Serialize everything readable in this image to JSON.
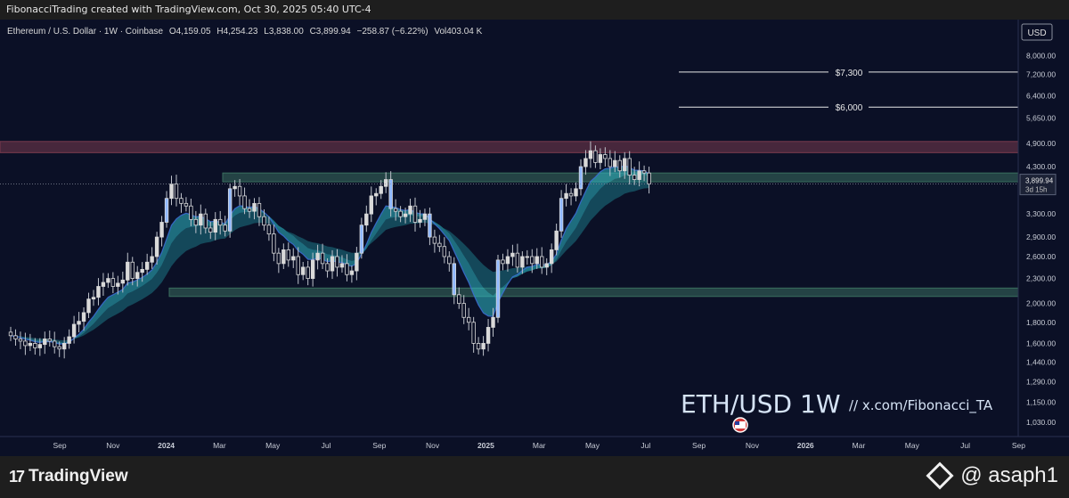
{
  "header": {
    "attribution": "FibonacciTrading created with TradingView.com, Oct 30, 2025 05:40 UTC-4"
  },
  "legend": {
    "symbol": "Ethereum / U.S. Dollar · 1W · Coinbase",
    "open": "O4,159.05",
    "high": "H4,254.23",
    "low": "L3,838.00",
    "close": "C3,899.94",
    "change": "−258.87 (−6.22%)",
    "volume": "Vol403.04 K"
  },
  "currency_label": "USD",
  "price_tag": {
    "value": "3,899.94",
    "countdown": "3d 15h"
  },
  "watermark": {
    "title": "ETH/USD 1W",
    "handle": "//  x.com/Fibonacci_TA"
  },
  "footer": {
    "brand": "TradingView",
    "credit": "@ asaph1"
  },
  "colors": {
    "background": "#0b1026",
    "candle_up": "#d9d9d9",
    "candle_down": "#d9d9d9",
    "candle_highlight": "#8fb8ff",
    "band_fast": "#2fb9c7",
    "band_slow": "#1e7f8e",
    "band_down": "#3f6fe0",
    "resistance_zone": "#7a3a4e",
    "support_zone": "#3a6e5e"
  },
  "chart_data": {
    "type": "candlestick",
    "y_axis": {
      "scale": "log",
      "range": [
        950,
        9500
      ],
      "ticks": [
        "8,000.00",
        "7,200.00",
        "6,400.00",
        "5,650.00",
        "4,900.00",
        "4,300.00",
        "3,300.00",
        "2,900.00",
        "2,600.00",
        "2,300.00",
        "2,000.00",
        "1,800.00",
        "1,600.00",
        "1,440.00",
        "1,290.00",
        "1,150.00",
        "1,030.00"
      ]
    },
    "x_axis": {
      "ticks": [
        "Sep",
        "Nov",
        "2024",
        "Mar",
        "May",
        "Jul",
        "Sep",
        "Nov",
        "2025",
        "Mar",
        "May",
        "Jul",
        "Sep",
        "Nov",
        "2026",
        "Mar",
        "May",
        "Jul",
        "Sep"
      ]
    },
    "horizontal_levels": [
      {
        "label": "$7,300",
        "value": 7300
      },
      {
        "label": "$6,000",
        "value": 6000
      }
    ],
    "zones": [
      {
        "name": "resistance",
        "low": 4650,
        "high": 4950
      },
      {
        "name": "support-upper",
        "low": 3950,
        "high": 4150
      },
      {
        "name": "support-lower",
        "low": 2080,
        "high": 2180
      }
    ],
    "weekly_closes": [
      1670,
      1640,
      1620,
      1580,
      1600,
      1560,
      1590,
      1640,
      1620,
      1570,
      1550,
      1600,
      1660,
      1780,
      1810,
      1900,
      2050,
      2070,
      2200,
      2250,
      2300,
      2200,
      2240,
      2280,
      2520,
      2300,
      2380,
      2420,
      2520,
      2600,
      2900,
      3150,
      3600,
      3900,
      3600,
      3500,
      3450,
      3200,
      3100,
      3300,
      3050,
      2980,
      3200,
      3100,
      3000,
      3800,
      3850,
      3650,
      3400,
      3350,
      3500,
      3250,
      3100,
      2950,
      2650,
      2500,
      2700,
      2550,
      2600,
      2350,
      2450,
      2300,
      2550,
      2650,
      2500,
      2400,
      2600,
      2450,
      2500,
      2350,
      2400,
      2650,
      3100,
      3300,
      3650,
      3700,
      3850,
      4000,
      3400,
      3350,
      3250,
      3300,
      3450,
      3150,
      3200,
      3300,
      2900,
      2800,
      2750,
      2600,
      2500,
      2100,
      2000,
      1850,
      1800,
      1600,
      1550,
      1600,
      1750,
      1850,
      2550,
      2500,
      2600,
      2650,
      2450,
      2600,
      2600,
      2500,
      2600,
      2450,
      2500,
      2700,
      3000,
      3600,
      3700,
      3650,
      3800,
      4300,
      4500,
      4700,
      4400,
      4600,
      4500,
      4300,
      4450,
      4200,
      4500,
      4100,
      4000,
      4200,
      4150,
      3900
    ]
  }
}
